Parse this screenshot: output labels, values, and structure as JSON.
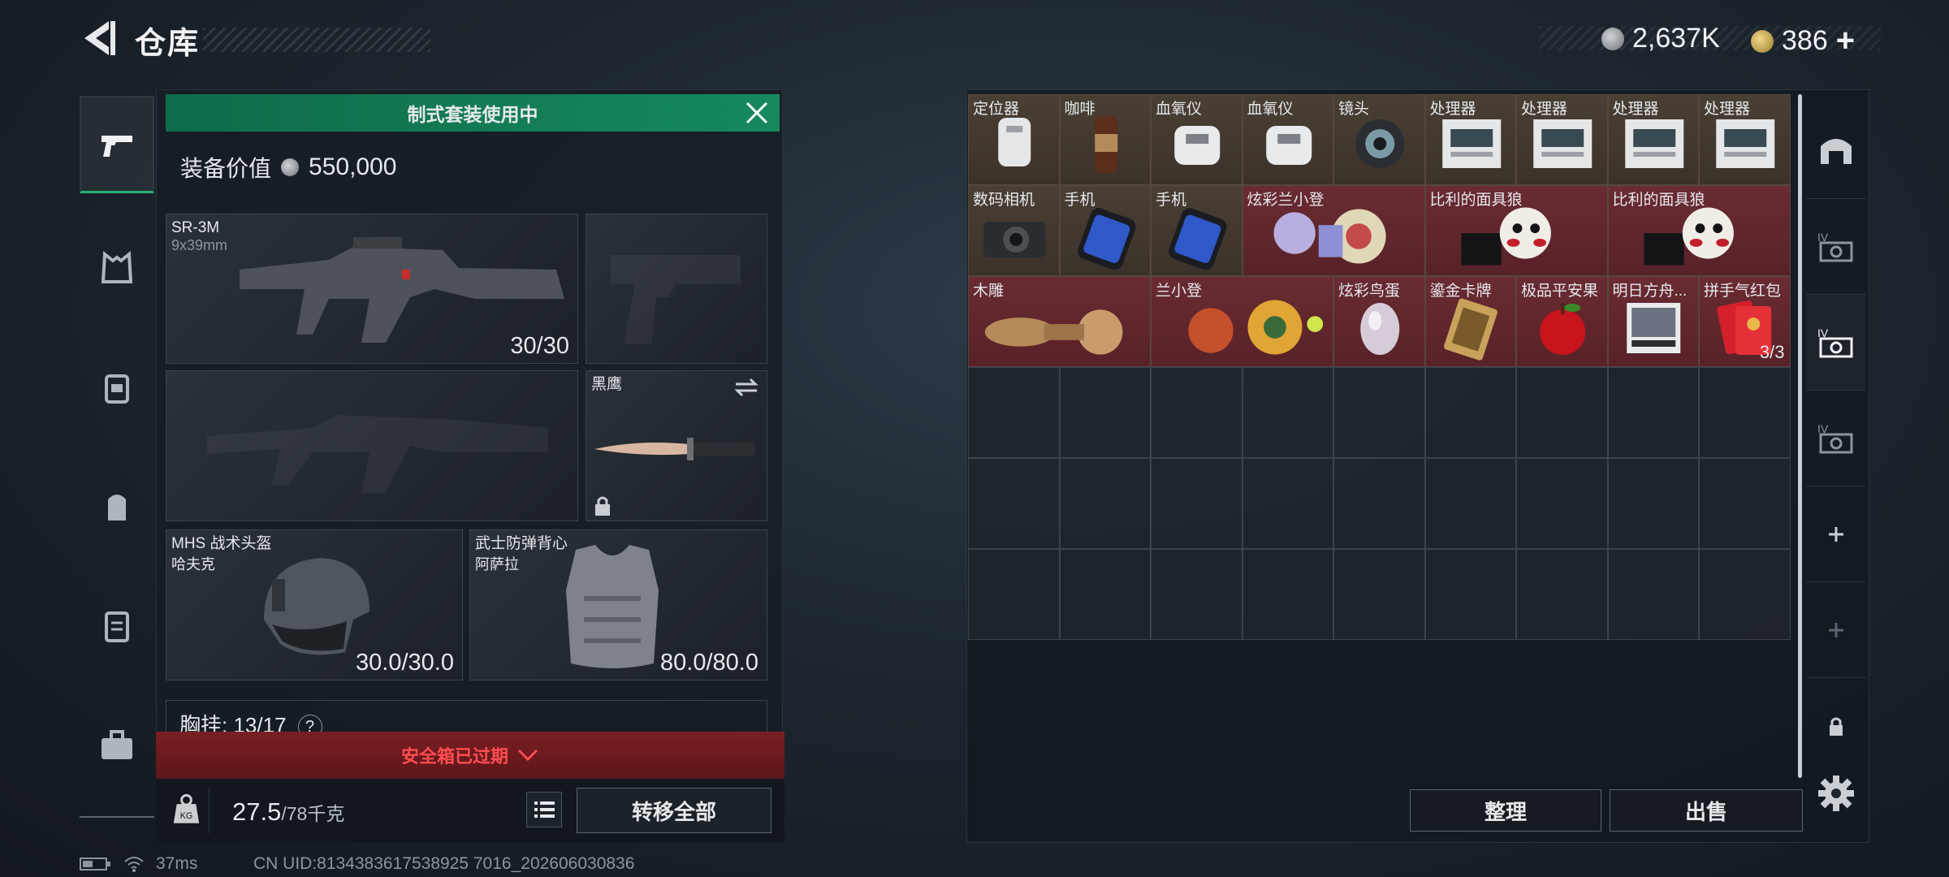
{
  "header": {
    "title": "仓库",
    "currency_a": "2,637K",
    "currency_b": "386",
    "topup": "+"
  },
  "loadout": {
    "banner": "制式套装使用中",
    "equip_value_label": "装备价值",
    "equip_value": "550,000",
    "primary": {
      "name": "SR-3M",
      "caliber": "9x39mm",
      "durability": "30/30"
    },
    "melee": {
      "name": "黑鹰"
    },
    "helmet": {
      "name": "MHS 战术头盔",
      "sub": "哈夫克",
      "durability": "30.0/30.0"
    },
    "vest": {
      "name": "武士防弹背心",
      "sub": "阿萨拉",
      "durability": "80.0/80.0"
    },
    "rig": {
      "label": "胸挂:",
      "capacity": "13/17",
      "help": "?"
    },
    "safebox": "安全箱已过期",
    "weight": "27.5",
    "weight_max": "/78千克",
    "kg_icon_text": "KG",
    "transfer_all": "转移全部"
  },
  "status": {
    "ping": "37ms",
    "uid": "CN UID:8134383617538925 7016_202606030836"
  },
  "stash": {
    "items": [
      {
        "label": "定位器",
        "icon": "locator-icon",
        "tint": "brown",
        "count": ""
      },
      {
        "label": "咖啡",
        "icon": "coffee-icon",
        "tint": "brown",
        "count": ""
      },
      {
        "label": "血氧仪",
        "icon": "oximeter-icon",
        "tint": "brown",
        "count": ""
      },
      {
        "label": "血氧仪",
        "icon": "oximeter-icon",
        "tint": "brown",
        "count": ""
      },
      {
        "label": "镜头",
        "icon": "lens-icon",
        "tint": "brown",
        "count": ""
      },
      {
        "label": "处理器",
        "icon": "processor-icon",
        "tint": "brown",
        "count": ""
      },
      {
        "label": "处理器",
        "icon": "processor-icon",
        "tint": "brown",
        "count": ""
      },
      {
        "label": "处理器",
        "icon": "processor-icon",
        "tint": "brown",
        "count": ""
      },
      {
        "label": "处理器",
        "icon": "processor-icon",
        "tint": "brown",
        "count": ""
      },
      {
        "label": "数码相机",
        "icon": "camera-icon",
        "tint": "brown",
        "count": ""
      },
      {
        "label": "手机",
        "icon": "phone-icon",
        "tint": "brown",
        "count": ""
      },
      {
        "label": "手机",
        "icon": "phone-icon",
        "tint": "brown",
        "count": ""
      },
      {
        "label": "炫彩兰小登",
        "icon": "colorful-figure-icon",
        "tint": "red",
        "count": ""
      },
      {
        "label": "比利的面具狼",
        "icon": "puppet-mask-icon",
        "tint": "red",
        "count": ""
      },
      {
        "label": "比利的面具狼",
        "icon": "puppet-mask-icon",
        "tint": "red",
        "count": ""
      },
      {
        "label": "木雕",
        "icon": "wood-carving-icon",
        "tint": "red",
        "count": ""
      },
      {
        "label": "兰小登",
        "icon": "figure-icon",
        "tint": "red",
        "count": ""
      },
      {
        "label": "炫彩鸟蛋",
        "icon": "egg-icon",
        "tint": "red",
        "count": ""
      },
      {
        "label": "鎏金卡牌",
        "icon": "gold-card-icon",
        "tint": "red",
        "count": ""
      },
      {
        "label": "极品平安果",
        "icon": "apple-icon",
        "tint": "red",
        "count": ""
      },
      {
        "label": "明日方舟...",
        "icon": "album-icon",
        "tint": "red",
        "count": ""
      },
      {
        "label": "拼手气红包",
        "icon": "red-envelope-icon",
        "tint": "red",
        "count": "3/3"
      }
    ],
    "sort": "整理",
    "sell": "出售"
  },
  "colors": {
    "accent_green": "#16895d",
    "warning_red": "#ff4d4f",
    "rare_red": "#6a2b32",
    "common_brown": "#4a3f34"
  }
}
